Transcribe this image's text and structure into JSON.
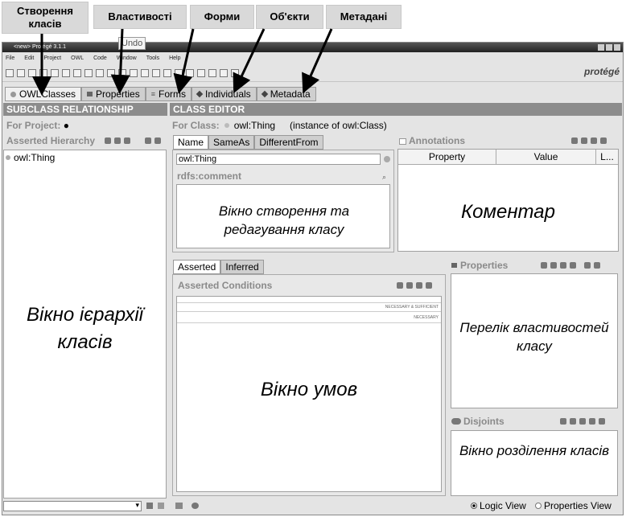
{
  "callouts": {
    "create_classes": "Створення класів",
    "properties": "Властивості",
    "forms": "Форми",
    "objects": "Об'єкти",
    "metadata": "Метадані"
  },
  "window": {
    "title": "<new> Protégé 3.1.1",
    "menu": [
      "File",
      "Edit",
      "Project",
      "OWL",
      "Code",
      "Window",
      "Tools",
      "Help"
    ],
    "logo": "protégé",
    "tooltip": "Undo"
  },
  "tabs": [
    {
      "label": "OWLClasses",
      "icon": "circle-icon"
    },
    {
      "label": "Properties",
      "icon": "square-icon"
    },
    {
      "label": "Forms",
      "icon": "lines-icon"
    },
    {
      "label": "Individuals",
      "icon": "diamond-icon"
    },
    {
      "label": "Metadata",
      "icon": "diamond-icon"
    }
  ],
  "left": {
    "header": "SUBCLASS RELATIONSHIP",
    "for_project": "For Project:",
    "hierarchy_label": "Asserted Hierarchy",
    "root_item": "owl:Thing",
    "caption": "Вікно ієрархії класів"
  },
  "editor": {
    "header": "CLASS EDITOR",
    "for_class_label": "For Class:",
    "for_class_value": "owl:Thing",
    "instance_of": "(instance of owl:Class)",
    "name_tabs": [
      "Name",
      "SameAs",
      "DifferentFrom"
    ],
    "name_value": "owl:Thing",
    "comment_label": "rdfs:comment",
    "caption": "Вікно створення та редагування класу"
  },
  "annotations": {
    "label": "Annotations",
    "columns": [
      "Property",
      "Value",
      "L..."
    ],
    "caption": "Коментар"
  },
  "conditions": {
    "tabs": [
      "Asserted",
      "Inferred"
    ],
    "label": "Asserted Conditions",
    "necessary_sufficient": "NECESSARY & SUFFICIENT",
    "necessary": "NECESSARY",
    "caption": "Вікно умов"
  },
  "properties_panel": {
    "label": "Properties",
    "caption": "Перелік властивостей класу"
  },
  "disjoints_panel": {
    "label": "Disjoints",
    "caption": "Вікно розділення класів"
  },
  "footer": {
    "logic_view": "Logic View",
    "properties_view": "Properties View"
  }
}
